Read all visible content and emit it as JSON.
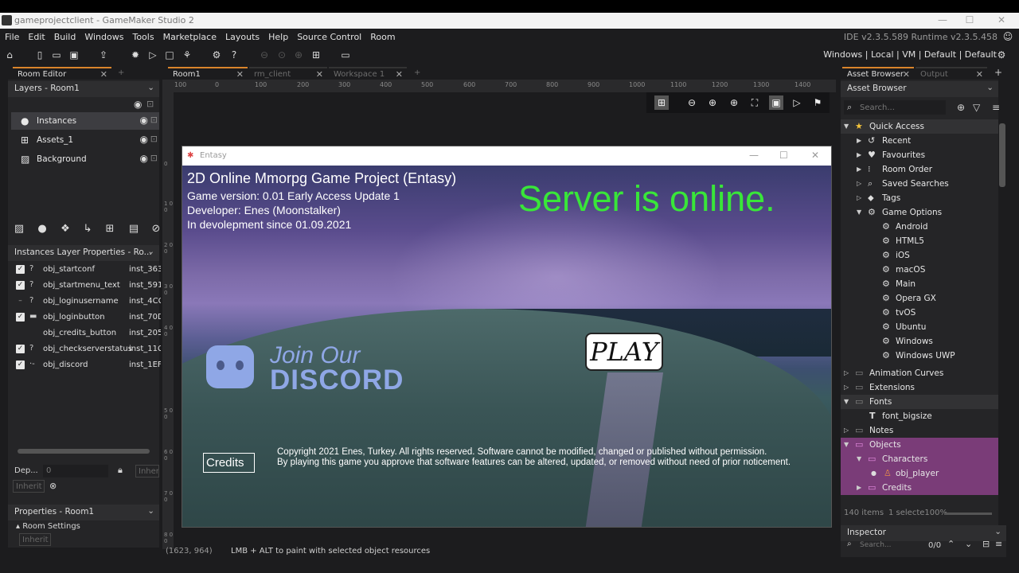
{
  "window": {
    "title": "gameprojectclient - GameMaker Studio 2"
  },
  "menu": [
    "File",
    "Edit",
    "Build",
    "Windows",
    "Tools",
    "Marketplace",
    "Layouts",
    "Help",
    "Source Control",
    "Room"
  ],
  "versions": "IDE v2.3.5.589  Runtime v2.3.5.458",
  "targets": "Windows | Local | VM | Default | Default",
  "left_tabs": {
    "room_editor": "Room Editor"
  },
  "layers": {
    "header": "Layers - Room1",
    "items": [
      "Instances",
      "Assets_1",
      "Background"
    ]
  },
  "instances": {
    "header": "Instances Layer Properties - Ro...",
    "rows": [
      {
        "name": "obj_startconf",
        "id": "inst_363"
      },
      {
        "name": "obj_startmenu_text",
        "id": "inst_591"
      },
      {
        "name": "obj_loginusername",
        "id": "inst_4CC"
      },
      {
        "name": "obj_loginbutton",
        "id": "inst_70D"
      },
      {
        "name": "obj_credits_button",
        "id": "inst_205"
      },
      {
        "name": "obj_checkserverstatus",
        "id": "inst_11C"
      },
      {
        "name": "obj_discord",
        "id": "inst_1EF"
      }
    ]
  },
  "depth": {
    "label": "Dep...",
    "value": "0",
    "inherit": "Inherit",
    "inherit2": "Inher"
  },
  "properties": {
    "header": "Properties - Room1",
    "room_settings": "Room Settings",
    "inherit": "Inherit"
  },
  "doc_tabs": [
    "Room1",
    "rm_client",
    "Workspace 1"
  ],
  "ruler_x": [
    "100",
    "0",
    "100",
    "200",
    "300",
    "400",
    "500",
    "600",
    "700",
    "800",
    "900",
    "1000",
    "1100",
    "1200",
    "1300",
    "1400"
  ],
  "ruler_y": [
    "0",
    "1 0 0",
    "2 0 0",
    "3 0 0",
    "4 0 0",
    "5 0 0",
    "6 0 0",
    "7 0 0",
    "8 0 0"
  ],
  "game": {
    "window_title": "Entasy",
    "lines": [
      "2D Online Mmorpg Game Project (Entasy)",
      "Game version: 0.01 Early Access Update 1",
      "Developer: Enes (Moonstalker)",
      "In devolepment since 01.09.2021"
    ],
    "server": "Server is online.",
    "play": "PLAY",
    "discord_join": "Join Our",
    "discord_word": "DISCORD",
    "credits": "Credits",
    "copyright1": "Copyright 2021 Enes, Turkey. All rights reserved. Software cannot be modified, changed or published without permission.",
    "copyright2": "By playing this game you approve that software features can be altered, updated, or removed without need of prior noticement."
  },
  "asset_browser": {
    "tab": "Asset Browser",
    "tab2": "Output",
    "header": "Asset Browser",
    "search": "Search...",
    "quick_access": "Quick Access",
    "qa_items": [
      "Recent",
      "Favourites",
      "Room Order",
      "Saved Searches",
      "Tags",
      "Game Options"
    ],
    "game_options": [
      "Android",
      "HTML5",
      "iOS",
      "macOS",
      "Main",
      "Opera GX",
      "tvOS",
      "Ubuntu",
      "Windows",
      "Windows UWP"
    ],
    "groups": [
      "Animation Curves",
      "Extensions",
      "Fonts",
      "font_bigsize",
      "Notes",
      "Objects",
      "Characters",
      "obj_player",
      "Credits"
    ],
    "count": "140 items",
    "selected": "1 selecte100%"
  },
  "inspector": {
    "title": "Inspector",
    "search": "Search...",
    "count": "0/0"
  },
  "status": {
    "coords": "(1623, 964)",
    "hint": "LMB + ALT to paint with selected object resources"
  }
}
